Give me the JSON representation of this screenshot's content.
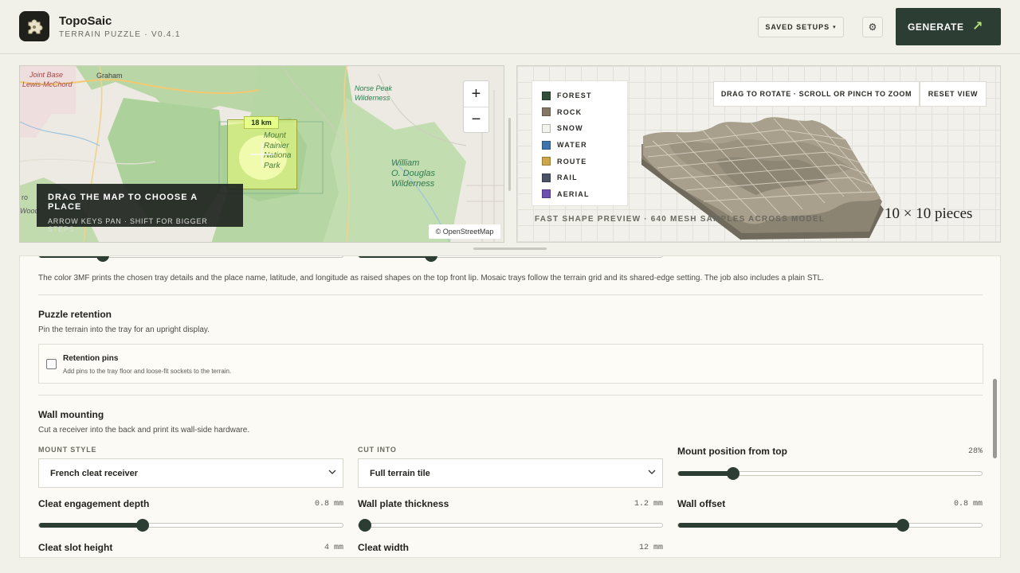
{
  "header": {
    "app_name": "TopoSaic",
    "app_subtitle": "TERRAIN PUZZLE · V0.4.1",
    "saved_setups_label": "SAVED SETUPS",
    "generate_label": "GENERATE",
    "logo_icon": "puzzle-piece-icon"
  },
  "map": {
    "labels": {
      "joint_base": "Joint Base",
      "lewis_mcchord": "Lewis-McChord",
      "graham": "Graham",
      "norse_peak_1": "Norse Peak",
      "norse_peak_2": "Wilderness",
      "rainier_1": "Mount",
      "rainier_2": "Rainier",
      "rainier_3": "Nationa",
      "rainier_4": "Park",
      "william_1": "William",
      "william_2": "O. Douglas",
      "william_3": "Wilderness",
      "edge_1": "ro",
      "edge_2": "Wood"
    },
    "selection_size": "18 km",
    "drag_title": "DRAG THE MAP TO CHOOSE A PLACE",
    "drag_subtitle": "ARROW KEYS PAN · SHIFT FOR BIGGER STEPS",
    "zoom_in": "+",
    "zoom_out": "−",
    "attribution": "© OpenStreetMap"
  },
  "preview": {
    "legend": [
      {
        "label": "FOREST",
        "color": "#2f4f3a"
      },
      {
        "label": "ROCK",
        "color": "#857766"
      },
      {
        "label": "SNOW",
        "color": "#f3f3ee"
      },
      {
        "label": "WATER",
        "color": "#3f73ad"
      },
      {
        "label": "ROUTE",
        "color": "#cda64a"
      },
      {
        "label": "RAIL",
        "color": "#4a5266"
      },
      {
        "label": "AERIAL",
        "color": "#6e4fb2"
      }
    ],
    "rotate_hint": "DRAG TO ROTATE · SCROLL OR PINCH TO ZOOM",
    "reset_view_label": "RESET VIEW",
    "caption": "FAST SHAPE PREVIEW · 640 MESH SAMPLES ACROSS MODEL",
    "pieces": "10 × 10 pieces"
  },
  "settings": {
    "tray_note": "The color 3MF prints the chosen tray details and the place name, latitude, and longitude as raised shapes on the top front lip. Mosaic trays follow the terrain grid and its shared-edge setting. The job also includes a plain STL.",
    "retention": {
      "title": "Puzzle retention",
      "subtitle": "Pin the terrain into the tray for an upright display.",
      "pins_label": "Retention pins",
      "pins_sub": "Add pins to the tray floor and loose-fit sockets to the terrain."
    },
    "wall": {
      "title": "Wall mounting",
      "subtitle": "Cut a receiver into the back and print its wall-side hardware.",
      "mount_style_label": "MOUNT STYLE",
      "mount_style_value": "French cleat receiver",
      "cut_into_label": "CUT INTO",
      "cut_into_value": "Full terrain tile",
      "mount_position_label": "Mount position from top",
      "mount_position_value": "28%",
      "mount_position_frac": 0.18,
      "cleat_depth_label": "Cleat engagement depth",
      "cleat_depth_value": "0.8 mm",
      "cleat_depth_frac": 0.34,
      "plate_label": "Wall plate thickness",
      "plate_value": "1.2 mm",
      "plate_frac": 0.02,
      "wall_offset_label": "Wall offset",
      "wall_offset_value": "0.8 mm",
      "wall_offset_frac": 0.74,
      "slot_height_label": "Cleat slot height",
      "slot_height_value": "4 mm",
      "cleat_width_label": "Cleat width",
      "cleat_width_value": "12 mm",
      "top_slider_a_frac": 0.21,
      "top_slider_b_frac": 0.24
    }
  }
}
